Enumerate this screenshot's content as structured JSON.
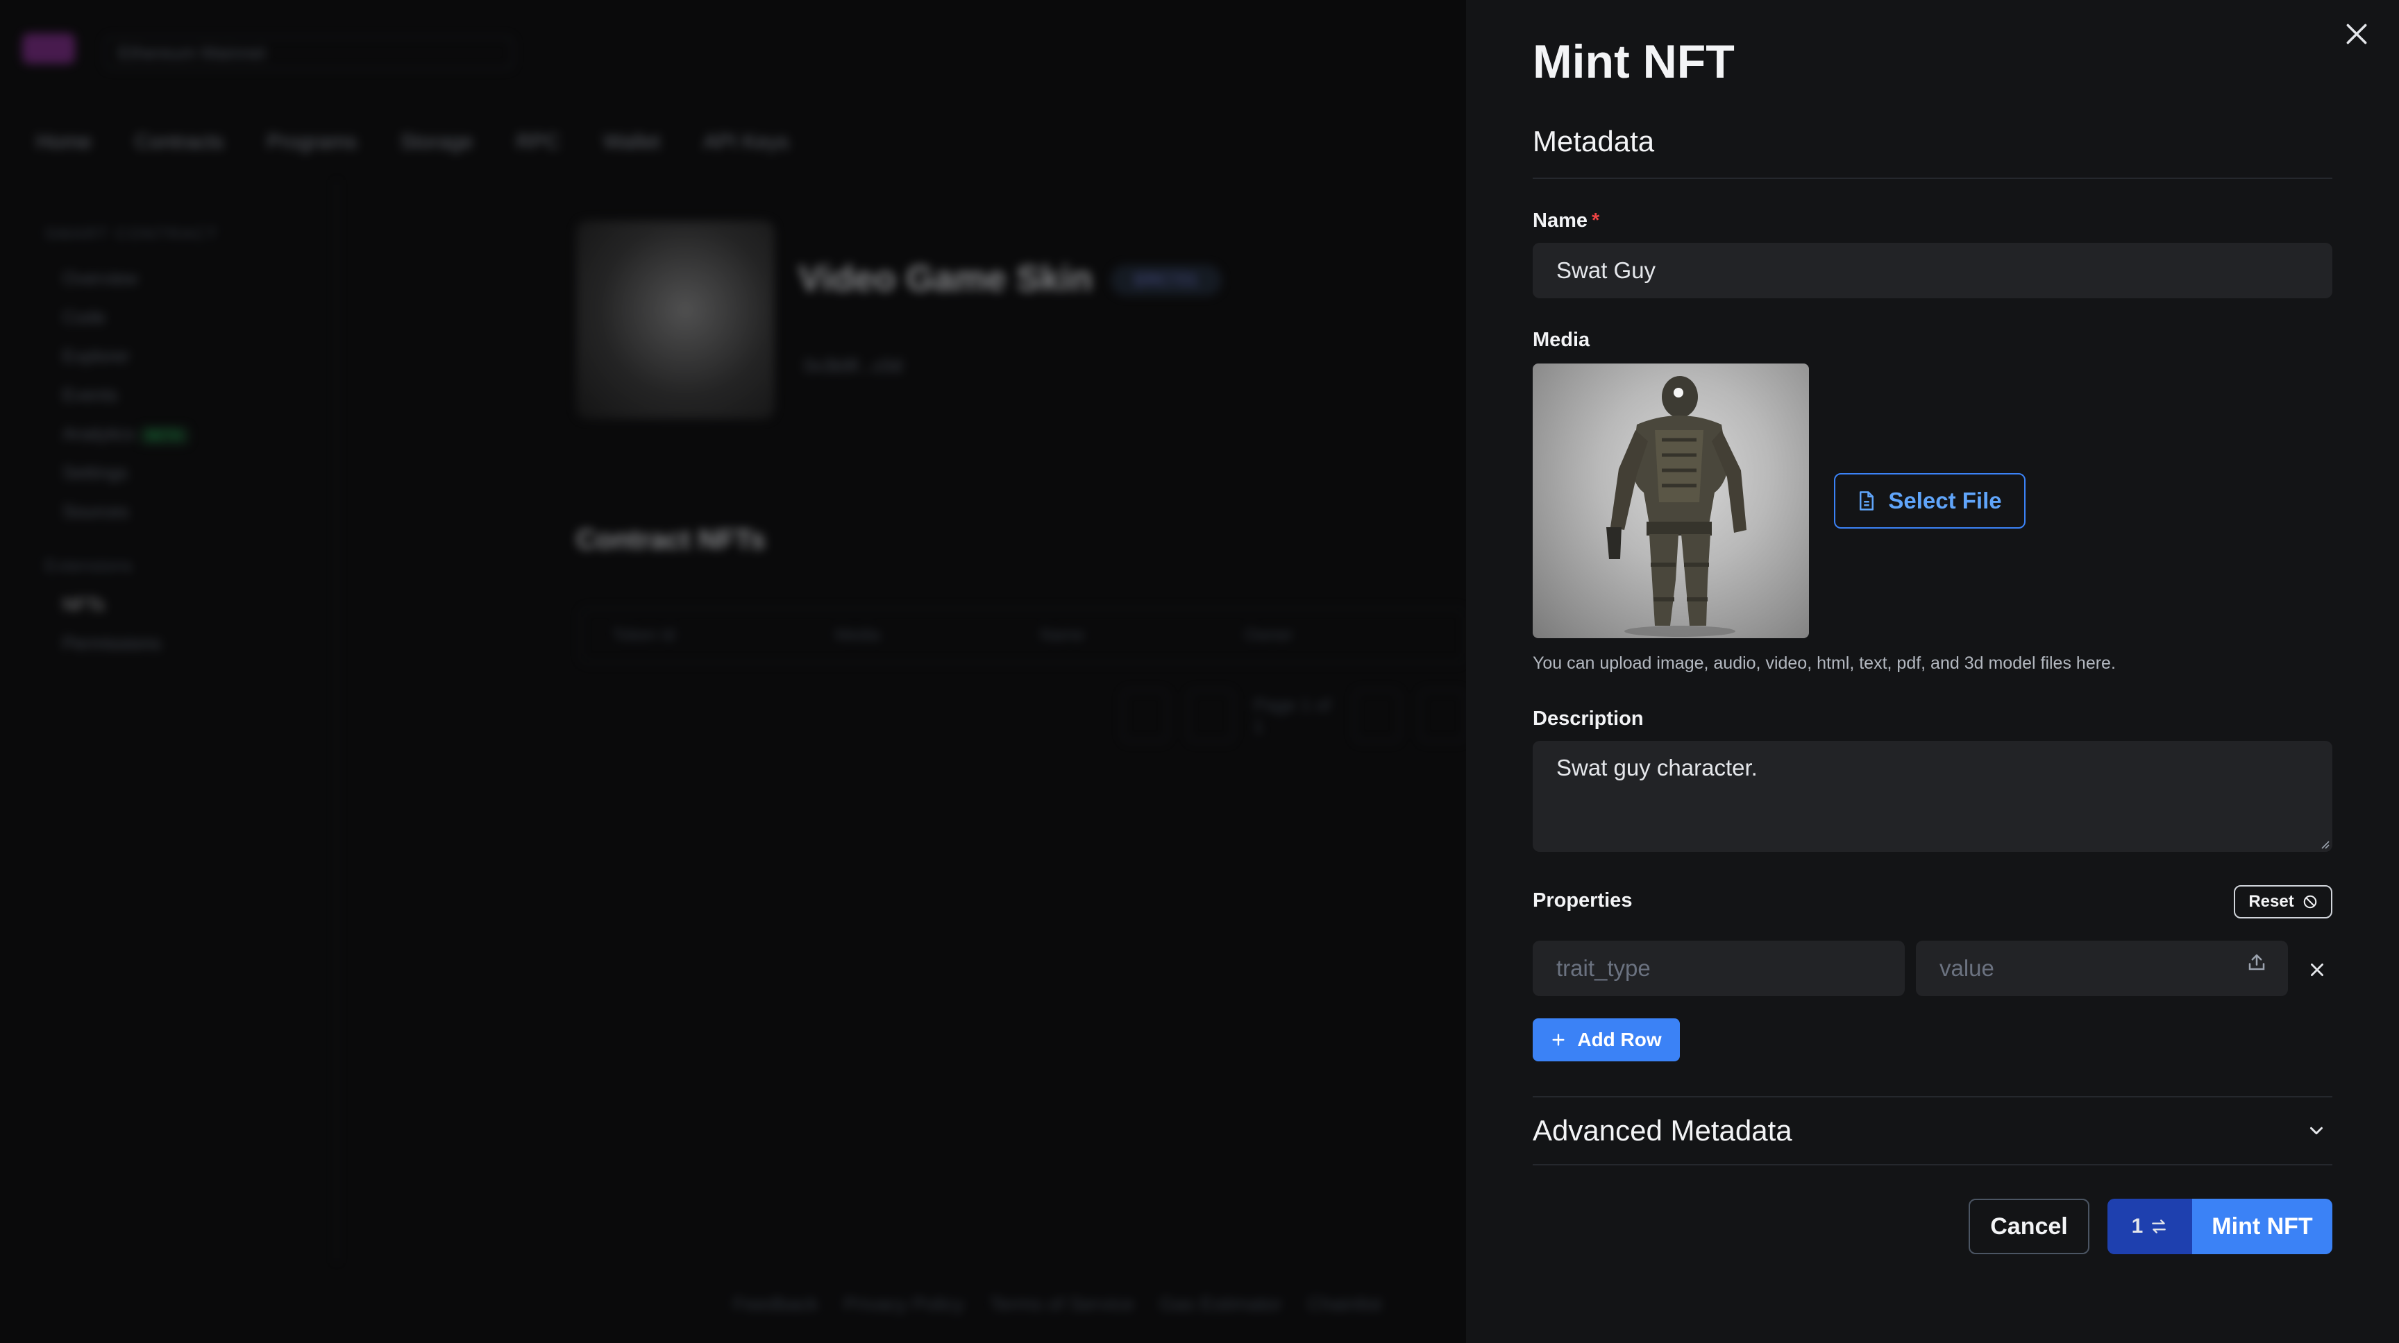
{
  "background": {
    "chain_selector": "Ethereum Mainnet",
    "tabs": [
      "Home",
      "Contracts",
      "Programs",
      "Storage",
      "RPC",
      "Wallet",
      "API Keys"
    ],
    "sidebar": {
      "heading": "SMART CONTRACT",
      "items": [
        "Overview",
        "Code",
        "Explorer",
        "Events",
        "Analytics",
        "Settings",
        "Sources"
      ],
      "beta_badge": "BETA",
      "group": "Extensions",
      "sub_items": [
        "NFTs",
        "Permissions"
      ]
    },
    "contract": {
      "title": "Video Game Skin",
      "badge": "ERC721",
      "address": "0x3b9f...c0d"
    },
    "section_title": "Contract NFTs",
    "table_headers": [
      "Token Id",
      "Media",
      "Name",
      "Owner"
    ],
    "pager": "Page 1 of 1",
    "footer_links": [
      "Feedback",
      "Privacy Policy",
      "Terms of Service",
      "Gas Estimator",
      "Chainlist"
    ]
  },
  "drawer": {
    "title": "Mint NFT",
    "section": "Metadata",
    "name": {
      "label": "Name",
      "required": "*",
      "value": "Swat Guy"
    },
    "media": {
      "label": "Media",
      "select_label": "Select File",
      "hint": "You can upload image, audio, video, html, text, pdf, and 3d model files here."
    },
    "description": {
      "label": "Description",
      "value": "Swat guy character."
    },
    "properties": {
      "label": "Properties",
      "reset_label": "Reset",
      "trait_placeholder": "trait_type",
      "value_placeholder": "value",
      "add_row_label": "Add Row"
    },
    "advanced": {
      "label": "Advanced Metadata"
    },
    "footer": {
      "cancel_label": "Cancel",
      "quantity": "1",
      "mint_label": "Mint NFT"
    }
  },
  "colors": {
    "accent": "#3b82f6",
    "panel": "#131416",
    "input": "#222326",
    "required": "#ef4444"
  },
  "icons": [
    "close-icon",
    "file-icon",
    "reset-icon",
    "upload-icon",
    "remove-icon",
    "plus-icon",
    "chevron-down-icon",
    "swap-icon"
  ]
}
